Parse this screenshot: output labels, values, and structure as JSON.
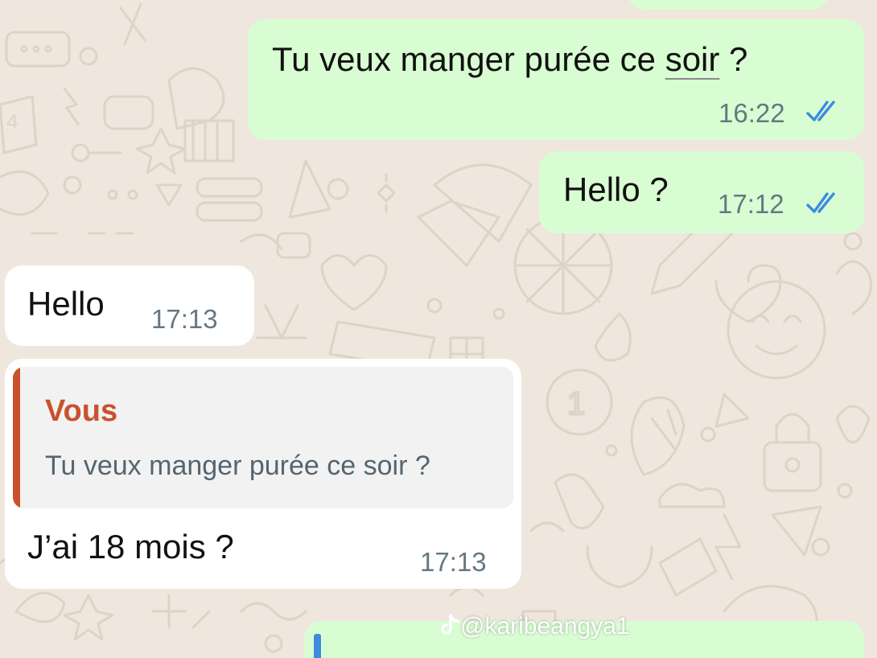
{
  "theme": {
    "outgoing_bubble": "#d9fdd3",
    "incoming_bubble": "#ffffff",
    "read_ticks": "#3d8be0",
    "reply_accent": "#c8522d",
    "wallpaper": "#efe7dd"
  },
  "messages": [
    {
      "direction": "outgoing",
      "text_before": "Tu veux manger purée ce ",
      "text_underlined": "soir",
      "text_after": " ?",
      "time": "16:22",
      "status_icon": "double-check-read-icon"
    },
    {
      "direction": "outgoing",
      "text": "Hello ?",
      "time": "17:12",
      "status_icon": "double-check-read-icon"
    },
    {
      "direction": "incoming",
      "text": "Hello",
      "time": "17:13"
    },
    {
      "direction": "incoming",
      "reply": {
        "author": "Vous",
        "text": "Tu veux manger purée ce soir ?"
      },
      "text": "J’ai 18 mois ?",
      "time": "17:13"
    }
  ],
  "watermark": {
    "icon": "tiktok-icon",
    "text": "@karibeangya1"
  }
}
